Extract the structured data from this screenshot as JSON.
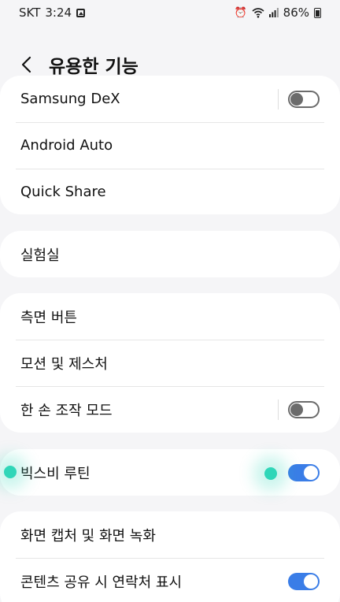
{
  "status_bar": {
    "carrier": "SKT",
    "time": "3:24",
    "image_icon": "image-icon",
    "alarm_icon": "alarm-icon",
    "wifi_icon": "wifi-icon",
    "signal_icon": "signal-icon",
    "battery_percent": "86%",
    "battery_icon": "battery-icon"
  },
  "header": {
    "title": "유용한 기능",
    "back_icon": "back-arrow-icon"
  },
  "groups": [
    {
      "items": [
        {
          "label": "Samsung DeX",
          "toggle": "off"
        },
        {
          "label": "Android Auto"
        },
        {
          "label": "Quick Share"
        }
      ]
    },
    {
      "items": [
        {
          "label": "실험실"
        }
      ]
    },
    {
      "items": [
        {
          "label": "측면 버튼"
        },
        {
          "label": "모션 및 제스처"
        },
        {
          "label": "한 손 조작 모드",
          "toggle": "off"
        }
      ]
    },
    {
      "items": [
        {
          "label": "빅스비 루틴",
          "toggle": "on"
        }
      ]
    },
    {
      "items": [
        {
          "label": "화면 캡처 및 화면 녹화"
        },
        {
          "label": "콘텐츠 공유 시 연락처 표시",
          "toggle": "on"
        }
      ]
    }
  ],
  "colors": {
    "accent": "#3a7de7",
    "touch_indicator": "#2fd6b8",
    "background": "#f5f5f7"
  }
}
